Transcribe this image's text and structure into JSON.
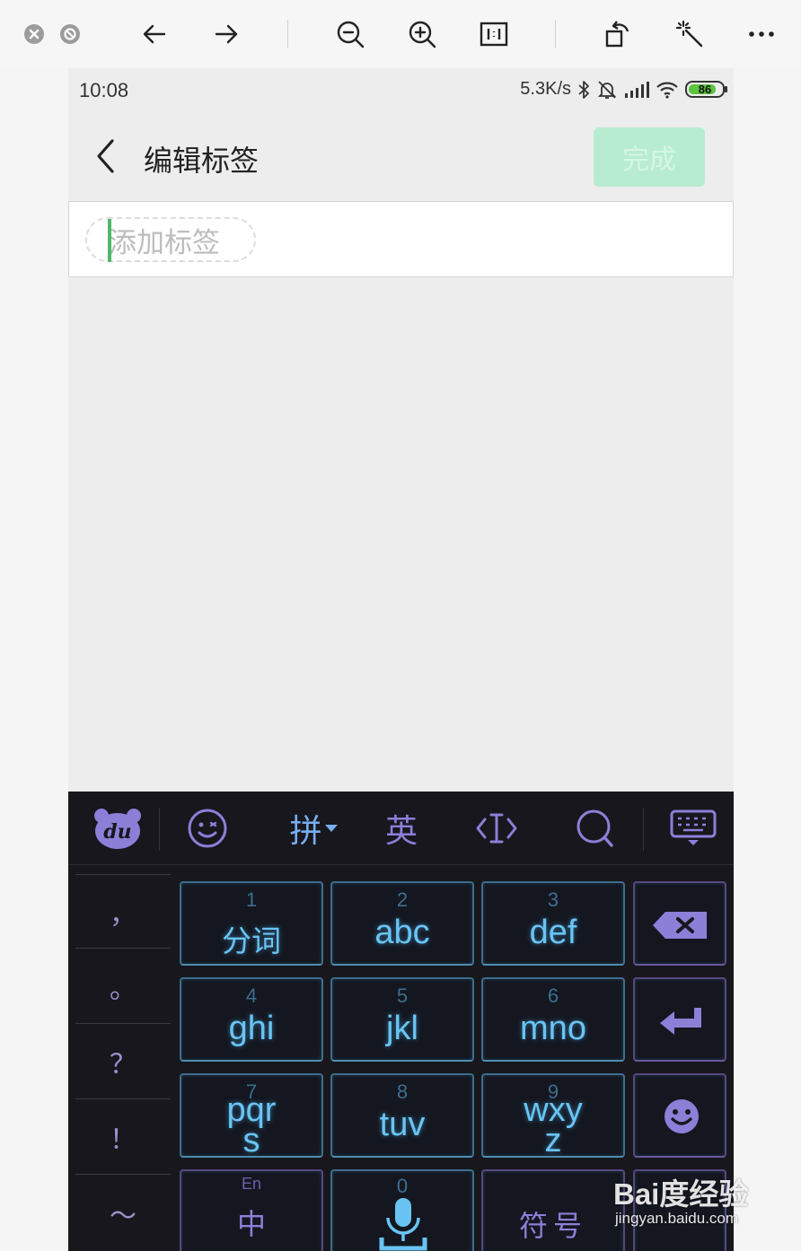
{
  "viewer": {
    "icons": [
      "close-icon",
      "disabled-icon",
      "arrow-left-icon",
      "arrow-right-icon",
      "zoom-out-icon",
      "zoom-in-icon",
      "actual-size-icon",
      "rotate-icon",
      "magic-wand-icon",
      "more-icon"
    ]
  },
  "status_bar": {
    "time": "10:08",
    "speed": "5.3K/s",
    "battery": "86",
    "battery_level": 0.86
  },
  "header": {
    "title": "编辑标签",
    "done_label": "完成"
  },
  "tag_input": {
    "placeholder": "添加标签"
  },
  "keyboard": {
    "toolbar": {
      "logo": "du",
      "pinyin": "拼",
      "english": "英"
    },
    "punctuation": [
      "，",
      "。",
      "？",
      "！",
      "～"
    ],
    "keys": [
      {
        "num": "1",
        "label": "分词"
      },
      {
        "num": "2",
        "label": "abc"
      },
      {
        "num": "3",
        "label": "def"
      },
      {
        "num": "4",
        "label": "ghi"
      },
      {
        "num": "5",
        "label": "jkl"
      },
      {
        "num": "6",
        "label": "mno"
      },
      {
        "num": "7",
        "label": "pqr",
        "label2": "s"
      },
      {
        "num": "8",
        "label": "tuv"
      },
      {
        "num": "9",
        "label": "wxy",
        "label2": "z"
      }
    ],
    "bottom": {
      "lang_top": "En",
      "lang_main": "中",
      "zero": "0",
      "symbols": "符号"
    }
  },
  "watermark": {
    "logo": "Bai度经验",
    "url": "jingyan.baidu.com"
  },
  "colors": {
    "accent_green": "#4fb86d",
    "done_disabled": "#b8ecd0",
    "keyboard_bg": "#17171d",
    "key_glow": "#69c4f3",
    "keyboard_purple": "#8c7fd8"
  }
}
